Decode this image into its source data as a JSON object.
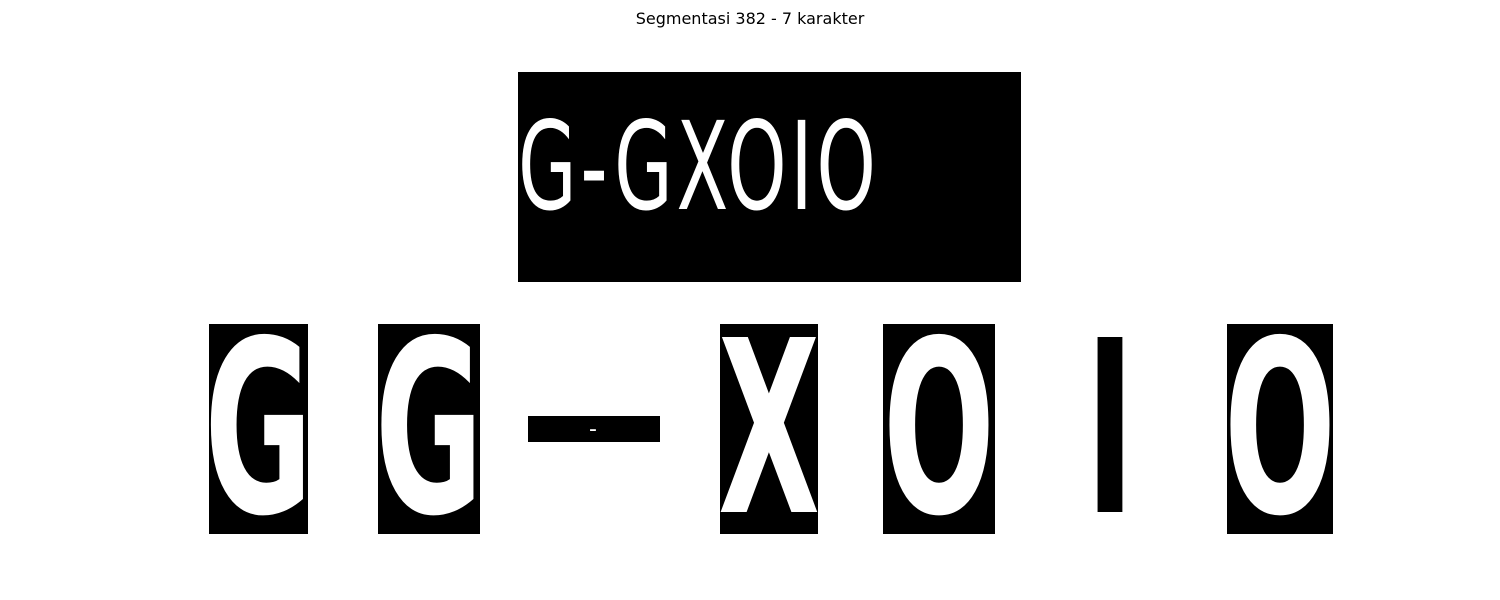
{
  "title": "Segmentasi 382 - 7 karakter",
  "plate_text": "G-GXOIO",
  "segments": [
    "G",
    "G",
    "-",
    "X",
    "O",
    "I",
    "O"
  ]
}
